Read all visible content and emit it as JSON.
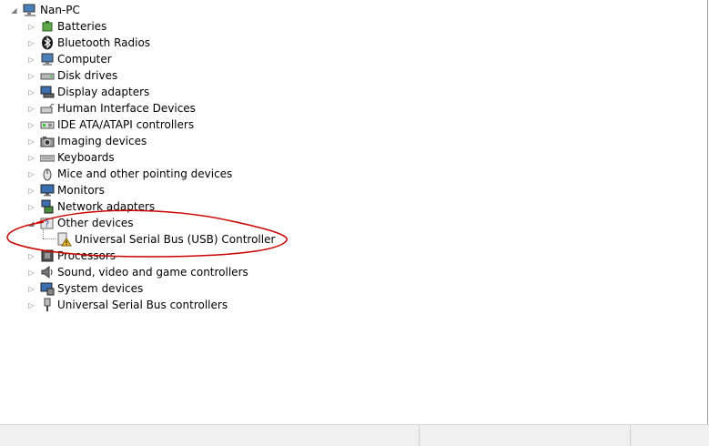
{
  "tree": {
    "root": {
      "label": "Nan-PC",
      "icon": "computer-icon"
    },
    "items": [
      {
        "label": "Batteries",
        "icon": "battery-icon",
        "name": "batteries"
      },
      {
        "label": "Bluetooth Radios",
        "icon": "bluetooth-icon",
        "name": "bluetooth-radios"
      },
      {
        "label": "Computer",
        "icon": "computer-icon",
        "name": "computer"
      },
      {
        "label": "Disk drives",
        "icon": "disk-drive-icon",
        "name": "disk-drives"
      },
      {
        "label": "Display adapters",
        "icon": "display-adapter-icon",
        "name": "display-adapters"
      },
      {
        "label": "Human Interface Devices",
        "icon": "hid-icon",
        "name": "human-interface-devices"
      },
      {
        "label": "IDE ATA/ATAPI controllers",
        "icon": "ide-controller-icon",
        "name": "ide-ata-atapi-controllers"
      },
      {
        "label": "Imaging devices",
        "icon": "camera-icon",
        "name": "imaging-devices"
      },
      {
        "label": "Keyboards",
        "icon": "keyboard-icon",
        "name": "keyboards"
      },
      {
        "label": "Mice and other pointing devices",
        "icon": "mouse-icon",
        "name": "mice-and-other-pointing-devices"
      },
      {
        "label": "Monitors",
        "icon": "monitor-icon",
        "name": "monitors"
      },
      {
        "label": "Network adapters",
        "icon": "network-adapter-icon",
        "name": "network-adapters"
      },
      {
        "label": "Other devices",
        "icon": "unknown-device-icon",
        "name": "other-devices",
        "expanded": true
      },
      {
        "label": "Processors",
        "icon": "processor-icon",
        "name": "processors"
      },
      {
        "label": "Sound, video and game controllers",
        "icon": "speaker-icon",
        "name": "sound-video-and-game-controllers"
      },
      {
        "label": "System devices",
        "icon": "system-device-icon",
        "name": "system-devices"
      },
      {
        "label": "Universal Serial Bus controllers",
        "icon": "usb-icon",
        "name": "universal-serial-bus-controllers"
      }
    ],
    "child": {
      "label": "Universal Serial Bus (USB) Controller",
      "icon": "warning-device-icon"
    }
  },
  "colors": {
    "annotation": "#cc0000",
    "warning": "#f2c230",
    "expander": "#7a7a7a"
  }
}
